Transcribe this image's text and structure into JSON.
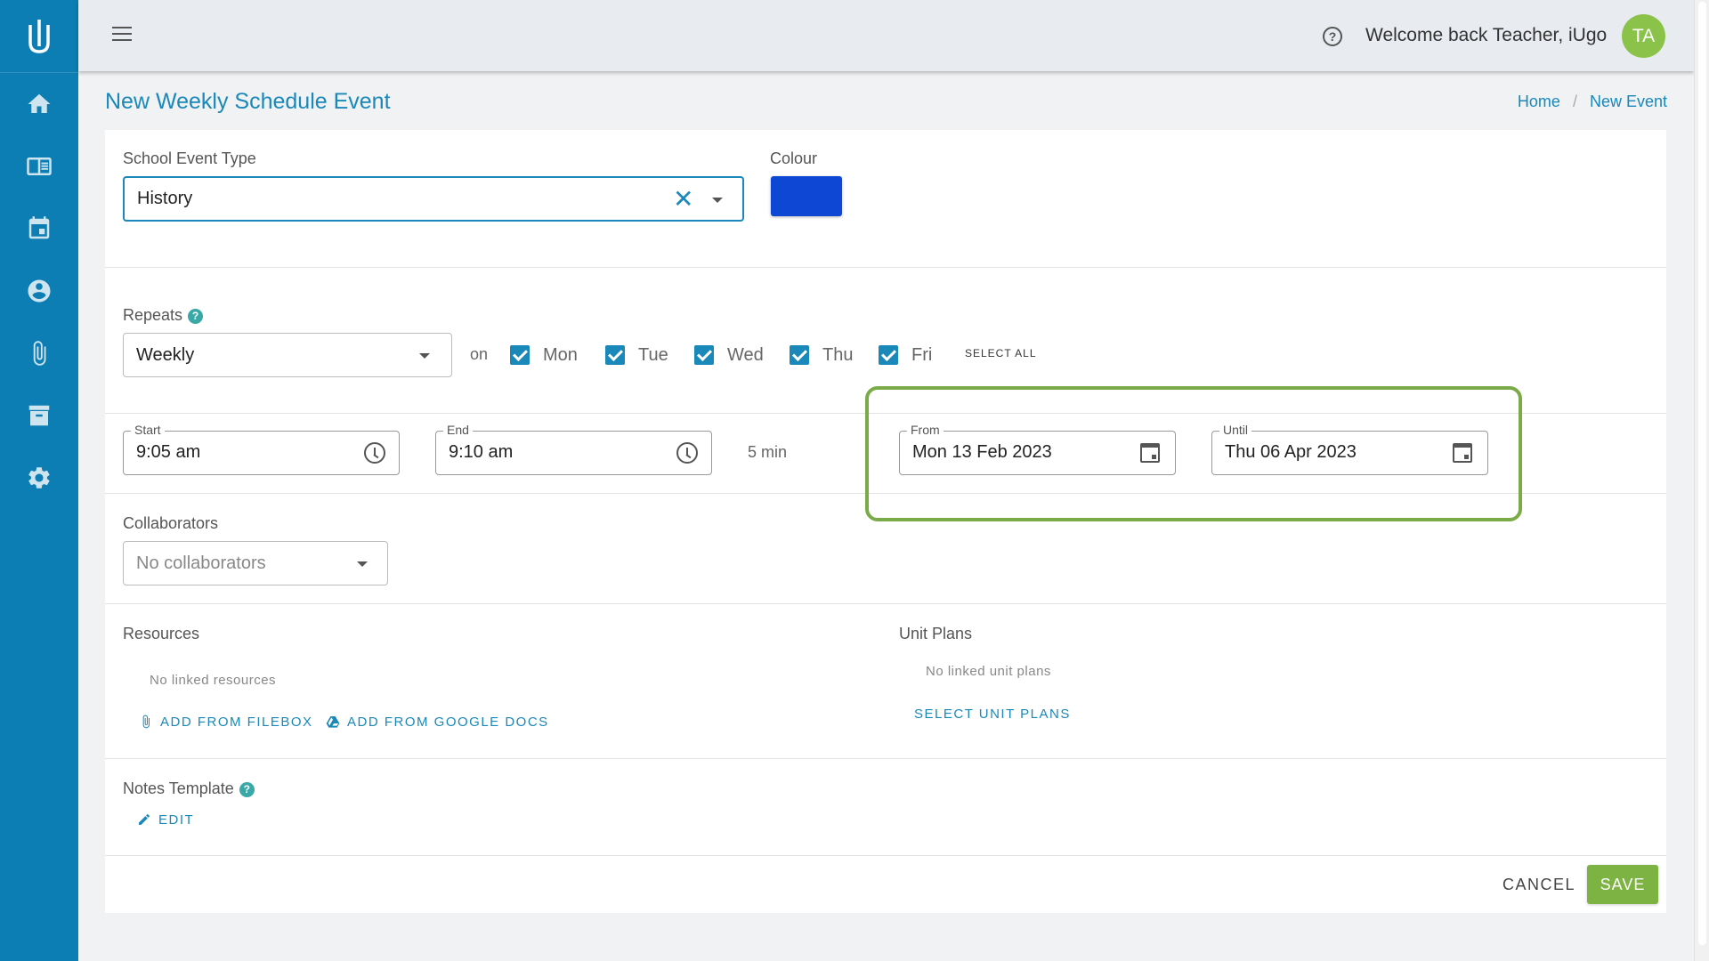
{
  "sidebar": {
    "items": [
      {
        "icon": "home-icon"
      },
      {
        "icon": "book-icon"
      },
      {
        "icon": "calendar-icon"
      },
      {
        "icon": "account-icon"
      },
      {
        "icon": "paperclip-icon"
      },
      {
        "icon": "archive-icon"
      },
      {
        "icon": "gear-icon"
      }
    ]
  },
  "header": {
    "welcome": "Welcome back Teacher, iUgo",
    "avatar_initials": "TA",
    "help_glyph": "?"
  },
  "page": {
    "title": "New Weekly Schedule Event",
    "breadcrumb": [
      "Home",
      "New Event"
    ],
    "breadcrumb_sep": "/"
  },
  "form": {
    "event_type_label": "School Event Type",
    "event_type_value": "History",
    "clear_glyph": "✕",
    "colour_label": "Colour",
    "colour_value": "#0d47d4",
    "repeats_label": "Repeats",
    "repeats_value": "Weekly",
    "on_label": "on",
    "days": [
      {
        "label": "Mon",
        "checked": true
      },
      {
        "label": "Tue",
        "checked": true
      },
      {
        "label": "Wed",
        "checked": true
      },
      {
        "label": "Thu",
        "checked": true
      },
      {
        "label": "Fri",
        "checked": true
      }
    ],
    "select_all": "SELECT ALL",
    "start_label": "Start",
    "start_value": "9:05 am",
    "end_label": "End",
    "end_value": "9:10 am",
    "duration": "5 min",
    "from_label": "From",
    "from_value": "Mon 13 Feb 2023",
    "until_label": "Until",
    "until_value": "Thu 06 Apr 2023",
    "collaborators_label": "Collaborators",
    "collaborators_placeholder": "No collaborators",
    "resources_label": "Resources",
    "resources_empty": "No linked resources",
    "add_from_filebox": "ADD FROM FILEBOX",
    "add_from_google_docs": "ADD FROM GOOGLE DOCS",
    "unit_plans_label": "Unit Plans",
    "unit_plans_empty": "No linked unit plans",
    "select_unit_plans": "SELECT UNIT PLANS",
    "notes_template_label": "Notes Template",
    "edit": "EDIT",
    "help_dot_glyph": "?"
  },
  "actions": {
    "cancel": "CANCEL",
    "save": "SAVE"
  },
  "colors": {
    "sidebar": "#0c7eb3",
    "accent": "#1a88b8",
    "save": "#7cb342",
    "highlight": "#7aab48",
    "avatar": "#8bc34a"
  }
}
